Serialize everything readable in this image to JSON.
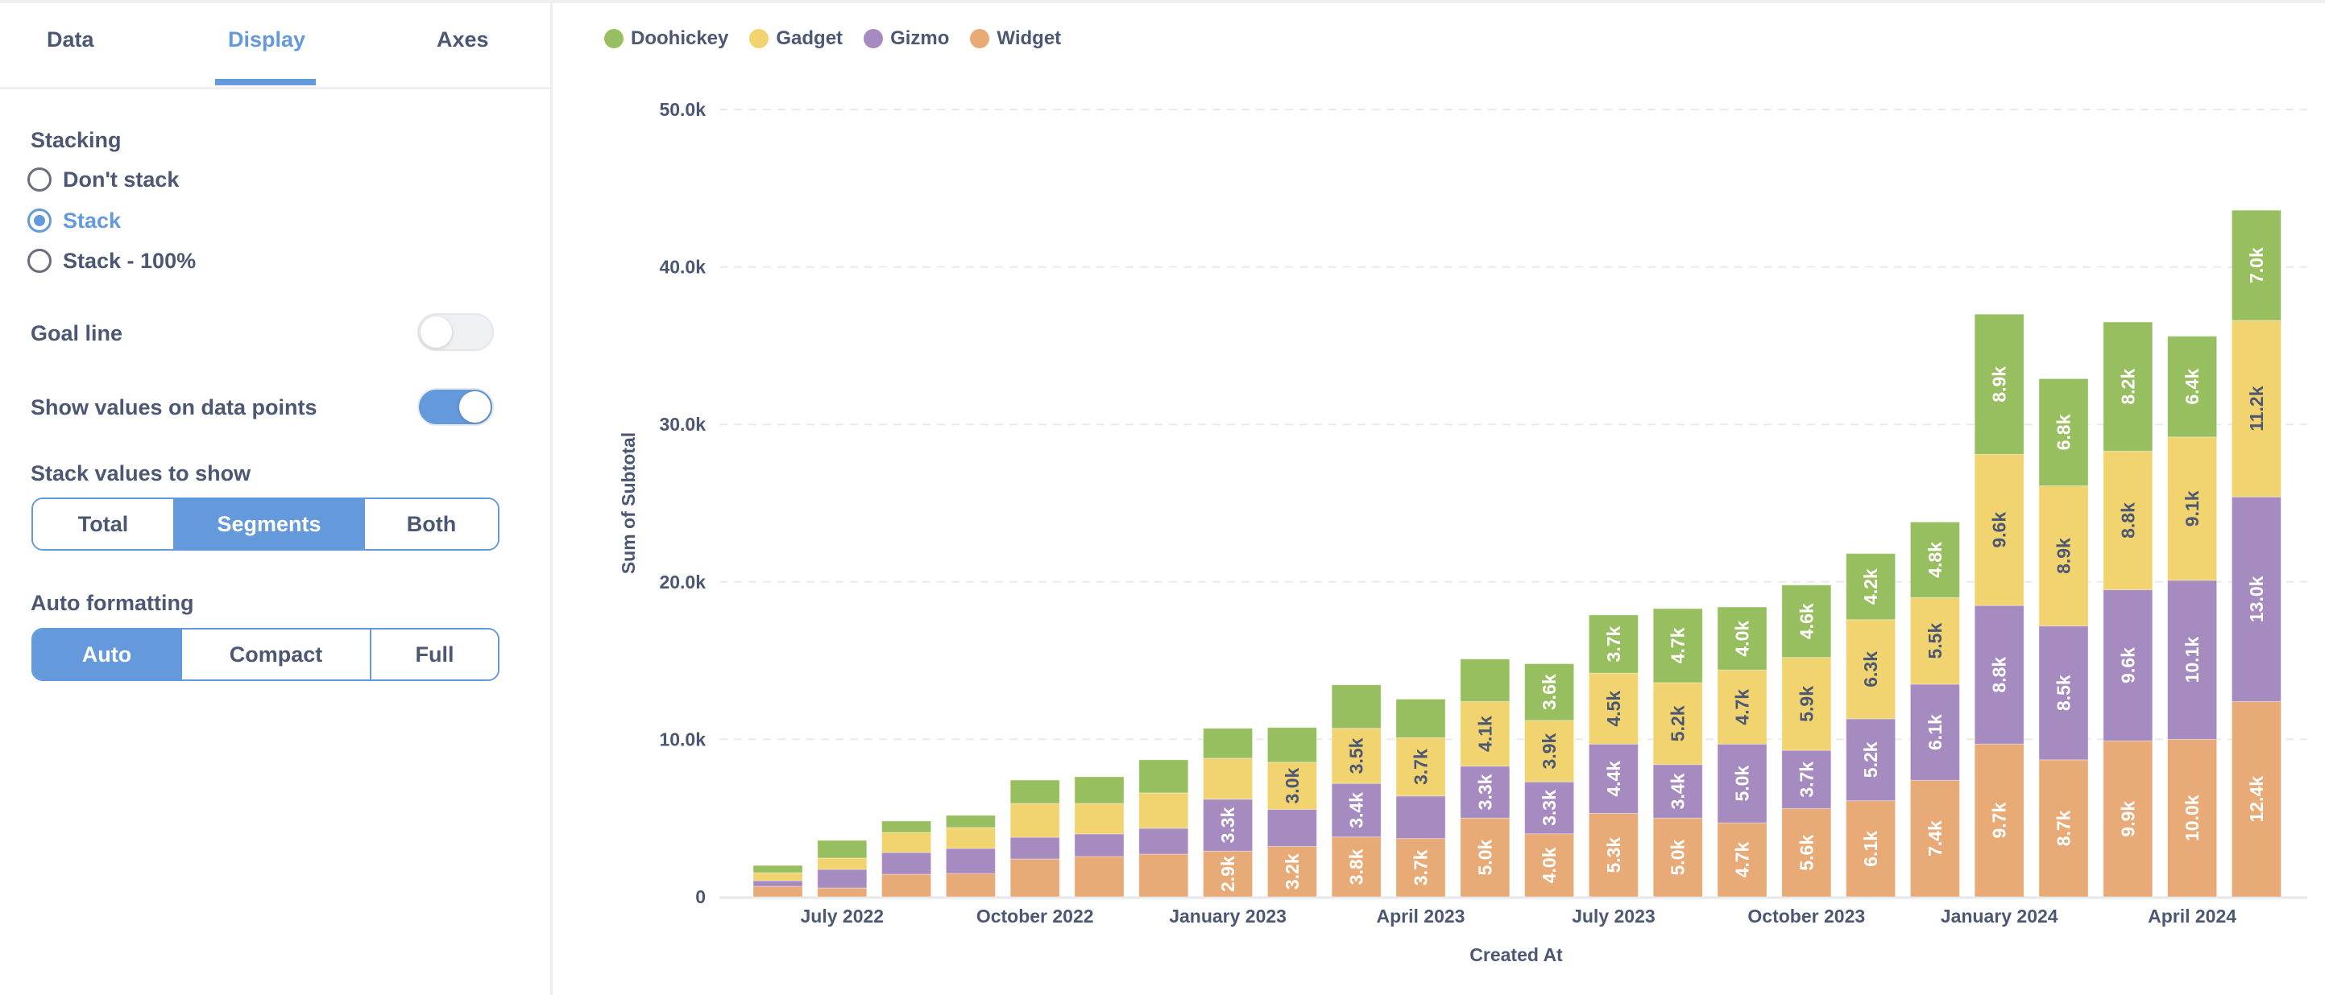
{
  "sidebar": {
    "tabs": [
      {
        "label": "Data",
        "active": false
      },
      {
        "label": "Display",
        "active": true
      },
      {
        "label": "Axes",
        "active": false
      }
    ],
    "stacking": {
      "label": "Stacking",
      "options": [
        {
          "label": "Don't stack",
          "checked": false
        },
        {
          "label": "Stack",
          "checked": true
        },
        {
          "label": "Stack - 100%",
          "checked": false
        }
      ]
    },
    "goal_line": {
      "label": "Goal line",
      "on": false
    },
    "show_values": {
      "label": "Show values on data points",
      "on": true
    },
    "stack_values": {
      "label": "Stack values to show",
      "options": [
        "Total",
        "Segments",
        "Both"
      ],
      "selected": "Segments"
    },
    "auto_formatting": {
      "label": "Auto formatting",
      "options": [
        "Auto",
        "Compact",
        "Full"
      ],
      "selected": "Auto"
    }
  },
  "colors": {
    "accent": "#6499DB",
    "text": "#4C5773",
    "Doohickey": "#98BF5F",
    "Gadget": "#F1D36F",
    "Gizmo": "#A68BC1",
    "Widget": "#E8AA76"
  },
  "chart_data": {
    "type": "bar",
    "stacked": true,
    "title": "",
    "xlabel": "Created At",
    "ylabel": "Sum of Subtotal",
    "ylim": [
      0,
      50000
    ],
    "yticks": [
      0,
      10000,
      20000,
      30000,
      40000,
      50000
    ],
    "ytick_labels": [
      "0",
      "10.0k",
      "20.0k",
      "30.0k",
      "40.0k",
      "50.0k"
    ],
    "grid": true,
    "legend_position": "top-left",
    "categories": [
      "June 2022",
      "July 2022",
      "August 2022",
      "September 2022",
      "October 2022",
      "November 2022",
      "December 2022",
      "January 2023",
      "February 2023",
      "March 2023",
      "April 2023",
      "May 2023",
      "June 2023",
      "July 2023",
      "August 2023",
      "September 2023",
      "October 2023",
      "November 2023",
      "December 2023",
      "January 2024",
      "February 2024",
      "March 2024",
      "April 2024",
      "May 2024"
    ],
    "xtick_labels": [
      {
        "index": 1,
        "label": "July 2022"
      },
      {
        "index": 4,
        "label": "October 2022"
      },
      {
        "index": 7,
        "label": "January 2023"
      },
      {
        "index": 10,
        "label": "April 2023"
      },
      {
        "index": 13,
        "label": "July 2023"
      },
      {
        "index": 16,
        "label": "October 2023"
      },
      {
        "index": 19,
        "label": "January 2024"
      },
      {
        "index": 22,
        "label": "April 2024"
      }
    ],
    "series": [
      {
        "name": "Widget",
        "values": [
          660,
          560,
          1430,
          1480,
          2400,
          2560,
          2710,
          2900,
          3200,
          3800,
          3700,
          5000,
          4000,
          5300,
          5000,
          4700,
          5600,
          6100,
          7400,
          9700,
          8700,
          9900,
          10000,
          12400
        ],
        "labels": [
          null,
          null,
          null,
          null,
          null,
          null,
          null,
          "2.9k",
          "3.2k",
          "3.8k",
          "3.7k",
          "5.0k",
          "4.0k",
          "5.3k",
          "5.0k",
          "4.7k",
          "5.6k",
          "6.1k",
          "7.4k",
          "9.7k",
          "8.7k",
          "9.9k",
          "10.0k",
          "12.4k"
        ]
      },
      {
        "name": "Gizmo",
        "values": [
          360,
          1180,
          1380,
          1590,
          1380,
          1430,
          1640,
          3300,
          2350,
          3400,
          2700,
          3300,
          3300,
          4400,
          3400,
          5000,
          3700,
          5200,
          6100,
          8800,
          8500,
          9600,
          10100,
          13000
        ],
        "labels": [
          null,
          null,
          null,
          null,
          null,
          null,
          null,
          "3.3k",
          null,
          "3.4k",
          null,
          "3.3k",
          "3.3k",
          "4.4k",
          "3.4k",
          "5.0k",
          "3.7k",
          "5.2k",
          "6.1k",
          "8.8k",
          "8.5k",
          "9.6k",
          "10.1k",
          "13.0k"
        ]
      },
      {
        "name": "Gadget",
        "values": [
          510,
          720,
          1280,
          1330,
          2150,
          1940,
          2250,
          2600,
          3000,
          3500,
          3700,
          4100,
          3900,
          4500,
          5200,
          4700,
          5900,
          6300,
          5500,
          9600,
          8900,
          8800,
          9100,
          11200
        ],
        "labels": [
          null,
          null,
          null,
          null,
          null,
          null,
          null,
          null,
          "3.0k",
          "3.5k",
          "3.7k",
          "4.1k",
          "3.9k",
          "4.5k",
          "5.2k",
          "4.7k",
          "5.9k",
          "6.3k",
          "5.5k",
          "9.6k",
          "8.9k",
          "8.8k",
          "9.1k",
          "11.2k"
        ]
      },
      {
        "name": "Doohickey",
        "values": [
          460,
          1120,
          720,
          770,
          1480,
          1690,
          2100,
          1900,
          2200,
          2760,
          2450,
          2700,
          3600,
          3700,
          4700,
          4000,
          4600,
          4200,
          4800,
          8900,
          6800,
          8200,
          6400,
          7000
        ],
        "labels": [
          null,
          null,
          null,
          null,
          null,
          null,
          null,
          null,
          null,
          null,
          null,
          null,
          "3.6k",
          "3.7k",
          "4.7k",
          "4.0k",
          "4.6k",
          "4.2k",
          "4.8k",
          "8.9k",
          "6.8k",
          "8.2k",
          "6.4k",
          "7.0k"
        ]
      }
    ],
    "legend": [
      "Doohickey",
      "Gadget",
      "Gizmo",
      "Widget"
    ]
  }
}
